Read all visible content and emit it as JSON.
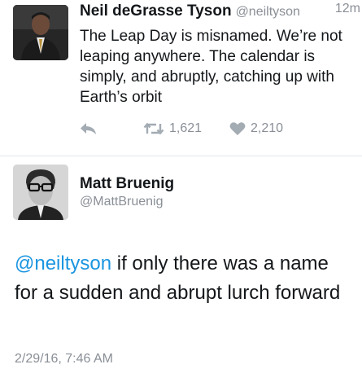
{
  "tweet1": {
    "name": "Neil deGrasse Tyson",
    "handle": "@neiltyson",
    "time": "12m",
    "text": "The Leap Day is misnamed. We’re not leaping anywhere. The calendar is simply, and abruptly, catching up with Earth’s orbit",
    "retweets": "1,621",
    "likes": "2,210",
    "icons": [
      "reply-icon",
      "retweet-icon",
      "heart-icon"
    ]
  },
  "tweet2": {
    "name": "Matt Bruenig",
    "handle": "@MattBruenig",
    "mention": "@neiltyson",
    "text_rest": " if only there was a name for a sudden and abrupt lurch forward",
    "date": "2/29/16, 7:46 AM"
  },
  "colors": {
    "link": "#1b95e0",
    "muted": "#8a8f96",
    "icon": "#a3abb3",
    "text": "#14171a",
    "divider": "#e1e8ed"
  }
}
